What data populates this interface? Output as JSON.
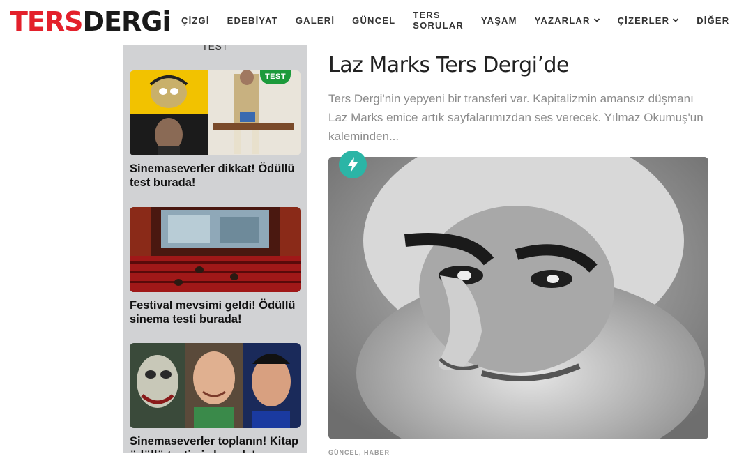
{
  "header": {
    "logo": {
      "part1": "TERS",
      "part2": "DERGi"
    },
    "nav": [
      {
        "label": "ÇİZGİ",
        "dropdown": false
      },
      {
        "label": "EDEBİYAT",
        "dropdown": false
      },
      {
        "label": "GALERİ",
        "dropdown": false
      },
      {
        "label": "GÜNCEL",
        "dropdown": false
      },
      {
        "label": "TERS SORULAR",
        "dropdown": false
      },
      {
        "label": "YAŞAM",
        "dropdown": false
      },
      {
        "label": "YAZARLAR",
        "dropdown": true
      },
      {
        "label": "ÇİZERLER",
        "dropdown": true
      },
      {
        "label": "DİĞER",
        "dropdown": true
      }
    ]
  },
  "sidebar": {
    "top_label": "TEST",
    "cards": [
      {
        "title": "Sinemaseverler dikkat! Ödüllü test burada!",
        "badge": "TEST"
      },
      {
        "title": "Festival mevsimi geldi! Ödüllü sinema testi burada!"
      },
      {
        "title": "Sinemaseverler toplanın! Kitap ödüllü testimiz burada!"
      }
    ]
  },
  "article": {
    "title": "Laz Marks Ters Dergi’de",
    "excerpt": "Ters Dergi'nin yepyeni bir transferi var. Kapitalizmin amansız düşmanı Laz Marks emice artık sayfalarımızdan ses verecek. Yılmaz Okumuş'un kaleminden...",
    "meta": "GÜNCEL, HABER"
  },
  "colors": {
    "brand_red": "#e3202b",
    "sidebar_bg": "#d1d2d4",
    "amp_teal": "#2bb5a6",
    "badge_green": "#1c9a3b"
  },
  "icons": {
    "dropdown": "chevron-down-icon",
    "amp": "lightning-bolt-icon"
  }
}
